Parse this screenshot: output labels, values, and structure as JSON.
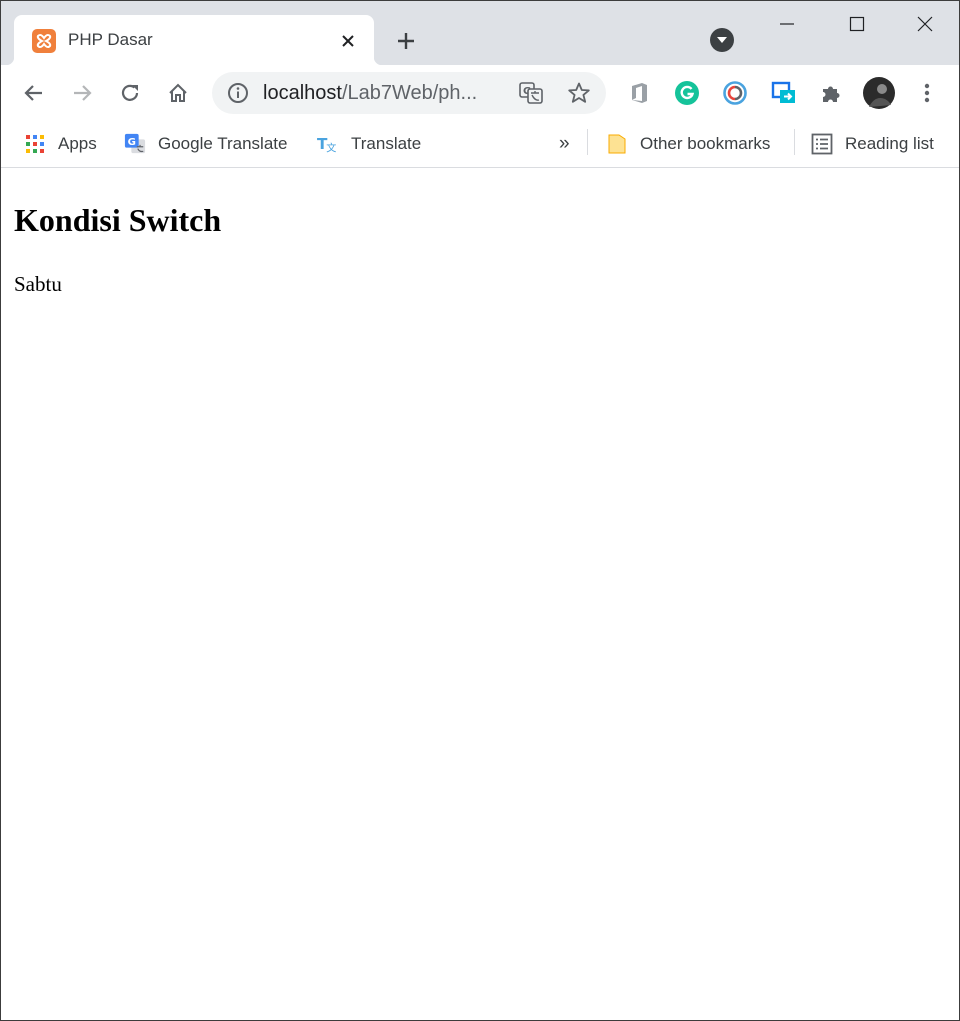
{
  "browser": {
    "tab": {
      "title": "PHP Dasar",
      "favicon": "xampp-icon"
    },
    "omnibox": {
      "host": "localhost",
      "path": "/Lab7Web/ph..."
    },
    "extensions": [
      "office-icon",
      "grammarly-icon",
      "sync-icon",
      "cast-icon",
      "puzzle-icon"
    ],
    "bookmarks": {
      "apps": "Apps",
      "google_translate": "Google Translate",
      "translate": "Translate",
      "overflow": "»",
      "other": "Other bookmarks",
      "reading_list": "Reading list"
    }
  },
  "page": {
    "heading": "Kondisi Switch",
    "result": "Sabtu"
  },
  "colors": {
    "tabstrip": "#dee1e6",
    "omnibox": "#f1f3f4",
    "favicon": "#f0803c",
    "icon": "#5f6368"
  }
}
